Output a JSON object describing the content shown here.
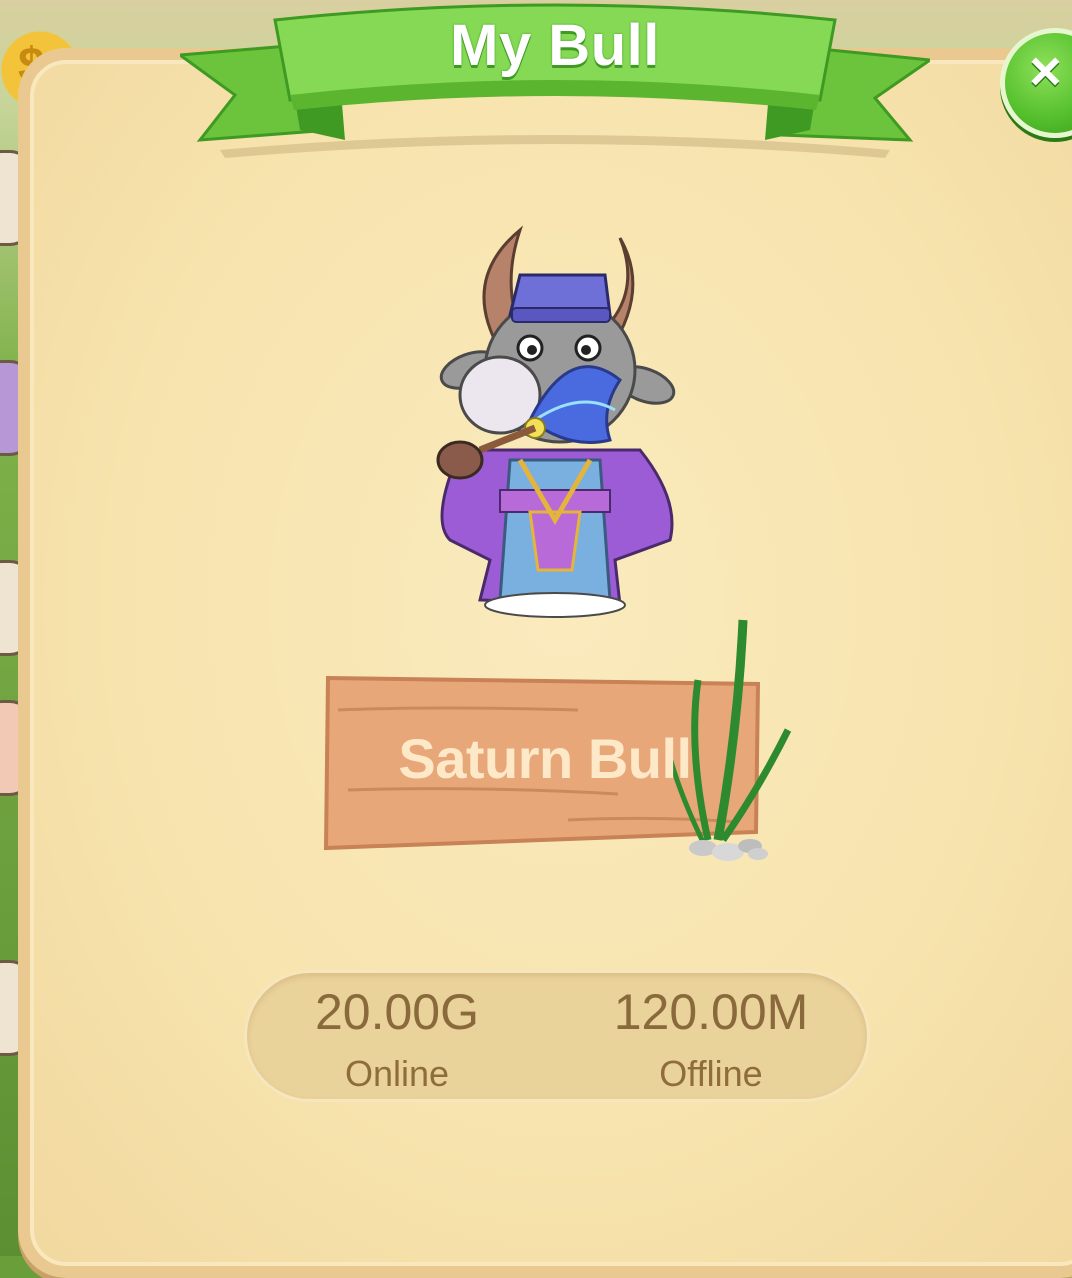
{
  "dialog": {
    "title": "My Bull",
    "close_icon": "close-icon"
  },
  "bull": {
    "name": "Saturn Bull",
    "image": "bull-character-illustration"
  },
  "stats": {
    "online_value": "20.00G",
    "online_label": "Online",
    "offline_value": "120.00M",
    "offline_label": "Offline"
  },
  "colors": {
    "ribbon_green": "#7fd24a",
    "panel_cream": "#f7e3ad",
    "sign_wood": "#e8a778",
    "stat_text": "#8a6a3c"
  }
}
